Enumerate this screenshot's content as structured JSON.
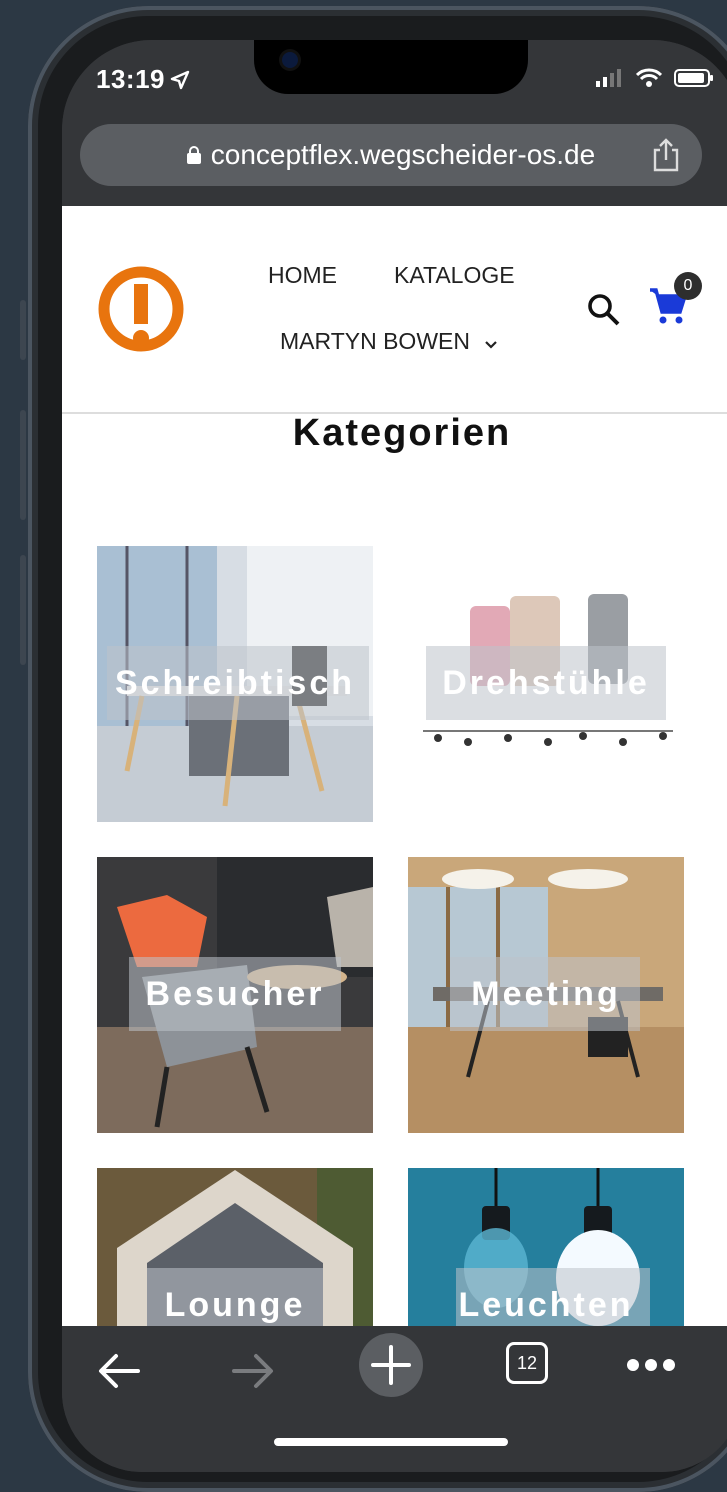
{
  "status_bar": {
    "time": "13:19"
  },
  "browser": {
    "url": "conceptflex.wegscheider-os.de",
    "tab_count": "12"
  },
  "nav": {
    "home": "HOME",
    "kataloge": "KATALOGE",
    "user": "MARTYN BOWEN",
    "cart_count": "0"
  },
  "page": {
    "heading": "Kategorien"
  },
  "categories": [
    {
      "label": "Schreibtisch"
    },
    {
      "label": "Drehstühle"
    },
    {
      "label": "Besucher"
    },
    {
      "label": "Meeting"
    },
    {
      "label": "Lounge"
    },
    {
      "label": "Leuchten"
    }
  ],
  "colors": {
    "logo": "#e8740e",
    "cart": "#1a3ad8",
    "page_bg": "#ffffff",
    "chrome": "#343639"
  },
  "icons": [
    "location-arrow-icon",
    "signal-icon",
    "wifi-icon",
    "battery-icon",
    "lock-icon",
    "share-icon",
    "search-icon",
    "cart-icon",
    "chevron-down-icon",
    "back-icon",
    "forward-icon",
    "plus-icon",
    "tabs-icon",
    "more-icon"
  ]
}
